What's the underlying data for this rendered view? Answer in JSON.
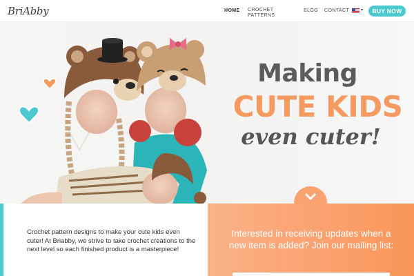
{
  "brand": {
    "logo_text": "BriAbby"
  },
  "nav": {
    "home": "HOME",
    "crochet_patterns": "CROCHET PATTERNS",
    "blog": "BLOG",
    "contact": "CONTACT",
    "language_flag_icon": "us-flag-icon",
    "buy_now": "BUY NOW"
  },
  "hero": {
    "headline_line1": "Making",
    "headline_line2": "CUTE KIDS",
    "headline_line3": "even cuter!",
    "scroll_icon": "chevron-down-icon"
  },
  "intro": {
    "text": "Crochet pattern designs to make your cute kids even cuter! At Briabby, we strive to take crochet creations to the next level so each finished product is a masterpiece!"
  },
  "mailing": {
    "text": "Interested in receiving updates when a new item is added? Join our mailing list:"
  },
  "colors": {
    "accent_teal": "#4cc9cf",
    "accent_orange": "#f59a60",
    "headline_gray": "#5b5b5b"
  }
}
